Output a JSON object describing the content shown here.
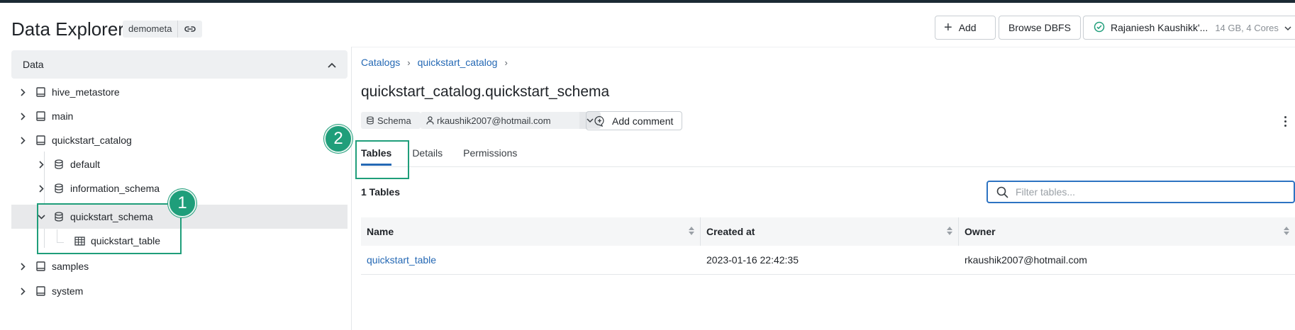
{
  "header": {
    "title": "Data Explorer",
    "metastore": "demometa",
    "add_label": "Add",
    "browse_label": "Browse DBFS",
    "cluster_name": "Rajaniesh Kaushikk'...",
    "cluster_specs": "14 GB, 4 Cores"
  },
  "sidebar": {
    "header": "Data",
    "items": [
      {
        "label": "hive_metastore"
      },
      {
        "label": "main"
      },
      {
        "label": "quickstart_catalog"
      },
      {
        "label": "default"
      },
      {
        "label": "information_schema"
      },
      {
        "label": "quickstart_schema"
      },
      {
        "label": "quickstart_table"
      },
      {
        "label": "samples"
      },
      {
        "label": "system"
      }
    ]
  },
  "annotations": {
    "badge_1": "1",
    "badge_2": "2"
  },
  "main": {
    "breadcrumb": [
      "Catalogs",
      "quickstart_catalog"
    ],
    "title": "quickstart_catalog.quickstart_schema",
    "type_chip": "Schema",
    "owner": "rkaushik2007@hotmail.com",
    "add_comment_label": "Add comment",
    "tabs": [
      {
        "label": "Tables"
      },
      {
        "label": "Details"
      },
      {
        "label": "Permissions"
      }
    ],
    "count_label": "1 Tables",
    "filter_placeholder": "Filter tables...",
    "columns": [
      "Name",
      "Created at",
      "Owner"
    ],
    "rows": [
      {
        "name": "quickstart_table",
        "created_at": "2023-01-16 22:42:35",
        "owner": "rkaushik2007@hotmail.com"
      }
    ]
  },
  "colors": {
    "accent": "#2468b4",
    "annotation": "#1f9e7a",
    "status_ok": "#1f9e7a"
  }
}
